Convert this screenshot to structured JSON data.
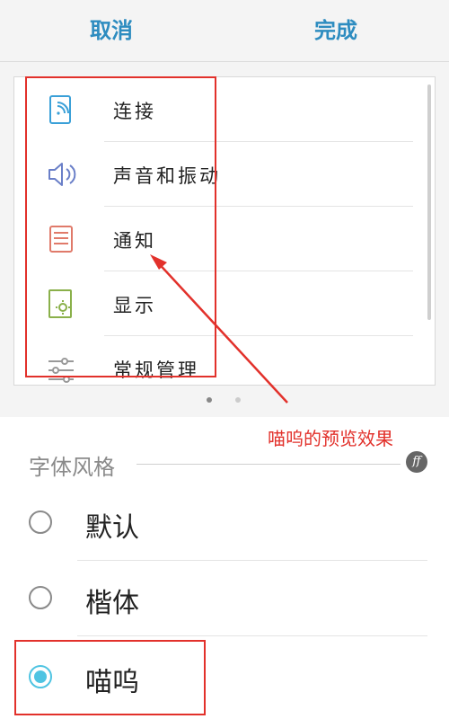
{
  "header": {
    "cancel_label": "取消",
    "done_label": "完成"
  },
  "preview": {
    "items": [
      {
        "label": "连接",
        "icon": "wifi-connection-icon"
      },
      {
        "label": "声音和振动",
        "icon": "speaker-icon"
      },
      {
        "label": "通知",
        "icon": "notification-icon"
      },
      {
        "label": "显示",
        "icon": "display-brightness-icon"
      },
      {
        "label": "常规管理",
        "icon": "sliders-icon"
      }
    ],
    "page_count": 2,
    "active_page": 1
  },
  "annotation": {
    "text": "喵呜的预览效果"
  },
  "font_style": {
    "title": "字体风格",
    "options": [
      {
        "label": "默认",
        "selected": false
      },
      {
        "label": "楷体",
        "selected": false
      },
      {
        "label": "喵呜",
        "selected": true
      }
    ]
  },
  "colors": {
    "accent": "#2d8cc0",
    "radio_selected": "#4fc4e2",
    "annotation": "#e2312b"
  }
}
